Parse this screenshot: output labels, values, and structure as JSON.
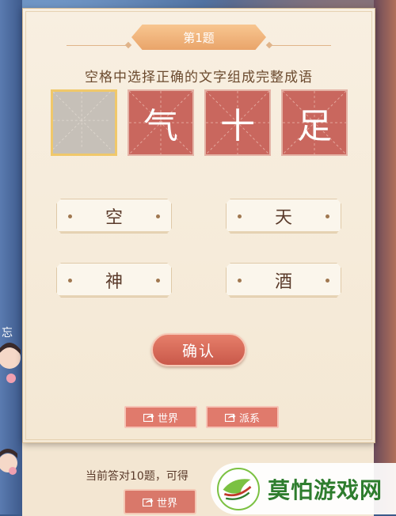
{
  "question": {
    "number_label": "第1题",
    "instruction": "空格中选择正确的文字组成完整成语"
  },
  "idiom_tiles": [
    {
      "char": ""
    },
    {
      "char": "气"
    },
    {
      "char": "十"
    },
    {
      "char": "足"
    }
  ],
  "options": [
    {
      "label": "空"
    },
    {
      "label": "天"
    },
    {
      "label": "神"
    },
    {
      "label": "酒"
    }
  ],
  "confirm_label": "确认",
  "share": {
    "world_label": "世界",
    "faction_label": "派系"
  },
  "underlay": {
    "progress_text": "当前答对10题，可得",
    "world_label": "世界"
  },
  "side_label": "忘",
  "watermark": {
    "text": "莫怕游戏网"
  },
  "colors": {
    "tile_red": "#c9675e",
    "button_red": "#e07a6c",
    "panel_bg": "#f8efe1",
    "banner_orange": "#f0b07a"
  }
}
